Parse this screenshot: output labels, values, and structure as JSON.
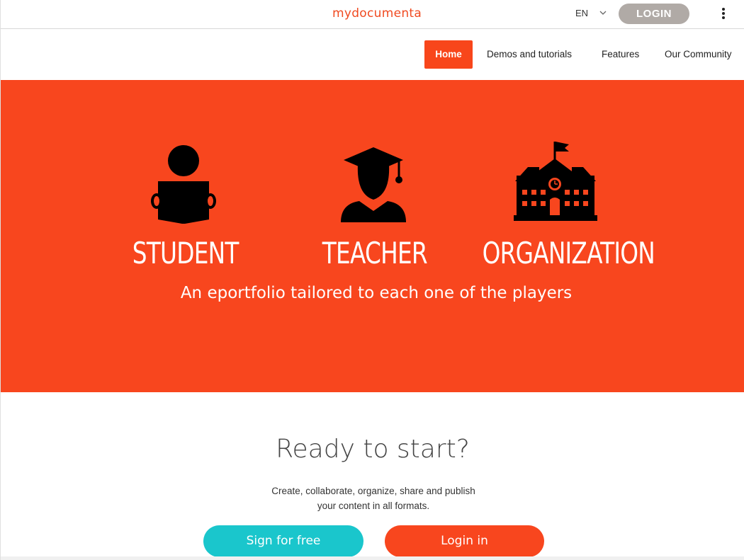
{
  "header": {
    "logo": "mydocumenta",
    "language": "EN",
    "login_label": "LOGIN"
  },
  "nav": {
    "items": [
      {
        "label": "Home",
        "active": true
      },
      {
        "label": "Demos and tutorials"
      },
      {
        "label": "Features"
      },
      {
        "label": "Our Community"
      }
    ]
  },
  "hero": {
    "players": [
      {
        "label": "STUDENT",
        "icon": "student-reading-icon"
      },
      {
        "label": "TEACHER",
        "icon": "graduate-teacher-icon"
      },
      {
        "label": "ORGANIZATION",
        "icon": "school-building-icon"
      }
    ],
    "tagline": "An eportfolio tailored to each one of the players"
  },
  "cta": {
    "title": "Ready to start?",
    "desc_line1": "Create, collaborate, organize, share and publish",
    "desc_line2": "your content in all formats.",
    "sign_label": "Sign for free",
    "login_label": "Login in"
  },
  "colors": {
    "brand": "#f8461e",
    "login_pill": "#b0aaa6",
    "teal": "#1ac6cc"
  }
}
